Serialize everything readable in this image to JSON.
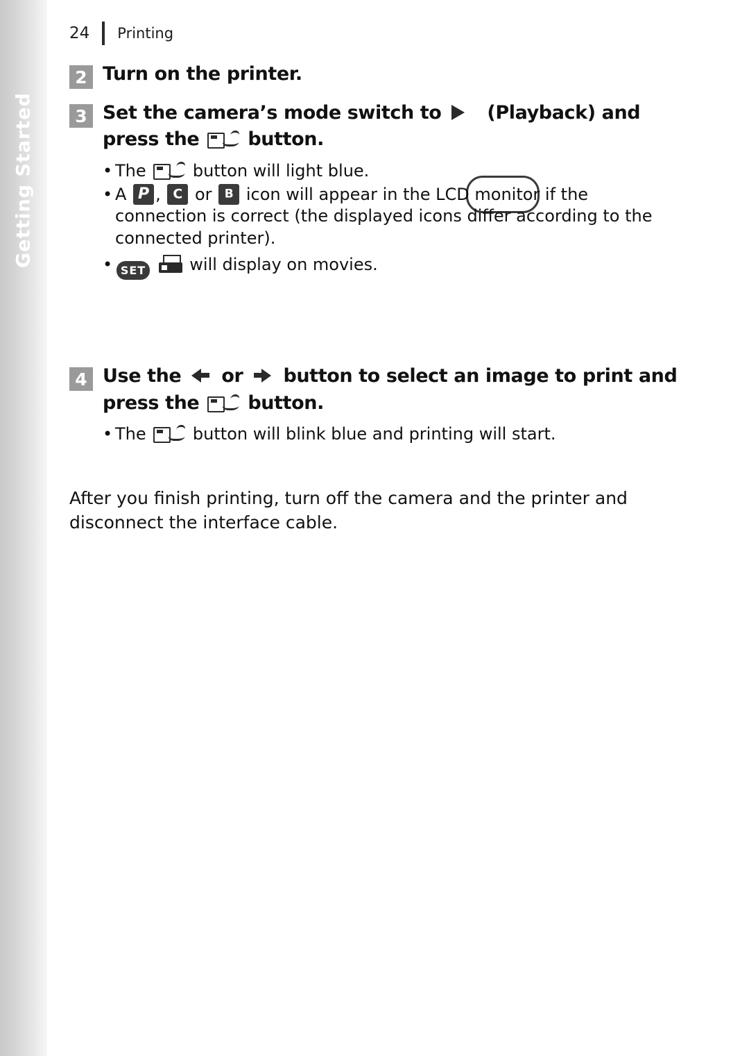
{
  "side_tab": {
    "label": "Getting Started"
  },
  "header": {
    "page_number": "24",
    "title": "Printing"
  },
  "steps": [
    {
      "number": "2",
      "text_parts": {
        "a": "Turn on the printer."
      }
    },
    {
      "number": "3",
      "text_parts": {
        "a": "Set the camera’s mode switch to",
        "b": "(Playback) and",
        "c": "press the",
        "d": "button."
      },
      "bullets": [
        {
          "lead": "The",
          "tail": "button will light blue.",
          "icon": "direct-print-button-icon"
        },
        {
          "lead": "A",
          "mid1": ",",
          "mid2": "or",
          "tail": "icon will appear in the LCD monitor if the connection is correct (the displayed icons differ according to the connected printer).",
          "icons": [
            "pictbridge-icon",
            "canon-selphy-icon",
            "bubble-jet-icon"
          ]
        },
        {
          "lead": "",
          "tail": "will display on movies.",
          "icons": [
            "set-button-icon",
            "movie-print-icon"
          ]
        }
      ]
    },
    {
      "number": "4",
      "text_parts": {
        "a": "Use the",
        "b": "or",
        "c": "button to select an image to print and",
        "d": "press the",
        "e": "button."
      },
      "bullets": [
        {
          "lead": "The",
          "tail": "button will blink blue and printing will start.",
          "icon": "direct-print-button-icon"
        }
      ]
    }
  ],
  "closing_paragraph": "After you finish printing, turn off the camera and the printer and disconnect the interface cable.",
  "icon_glyphs": {
    "pictbridge": "P",
    "canon_selphy": "C",
    "bubble_jet": "B",
    "set": "SET"
  },
  "bullet_marker": "•"
}
